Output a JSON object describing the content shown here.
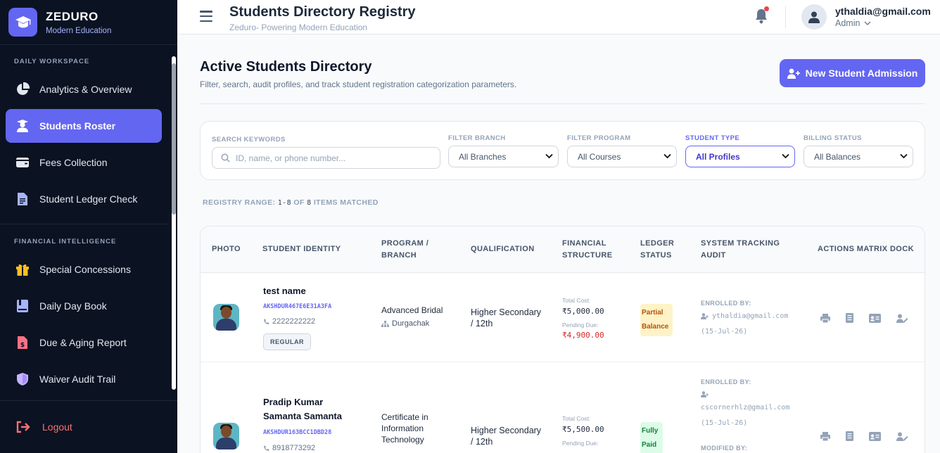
{
  "brand": {
    "name": "ZEDURO",
    "tagline": "Modern Education"
  },
  "sidebar": {
    "sections": [
      {
        "title": "DAILY WORKSPACE"
      },
      {
        "title": "FINANCIAL INTELLIGENCE"
      }
    ],
    "items": [
      {
        "label": "Analytics & Overview",
        "icon": "pie-chart-icon"
      },
      {
        "label": "Students Roster",
        "icon": "user-graduate-icon",
        "active": true
      },
      {
        "label": "Fees Collection",
        "icon": "wallet-icon"
      },
      {
        "label": "Student Ledger Check",
        "icon": "file-invoice-icon"
      },
      {
        "label": "Special Concessions",
        "icon": "gift-icon"
      },
      {
        "label": "Daily Day Book",
        "icon": "book-icon"
      },
      {
        "label": "Due & Aging Report",
        "icon": "file-dollar-icon"
      },
      {
        "label": "Waiver Audit Trail",
        "icon": "shield-icon"
      }
    ],
    "logout": "Logout"
  },
  "header": {
    "title": "Students Directory Registry",
    "subtitle": "Zeduro- Powering Modern Education",
    "user_email": "ythaldia@gmail.com",
    "user_role": "Admin"
  },
  "main": {
    "title": "Active Students Directory",
    "subtitle": "Filter, search, audit profiles, and track student registration categorization parameters.",
    "new_button": "New Student Admission"
  },
  "filters": {
    "search_label": "SEARCH KEYWORDS",
    "search_placeholder": "ID, name, or phone number...",
    "branch_label": "FILTER BRANCH",
    "branch_value": "All Branches",
    "program_label": "FILTER PROGRAM",
    "program_value": "All Courses",
    "type_label": "STUDENT TYPE",
    "type_value": "All Profiles",
    "billing_label": "BILLING STATUS",
    "billing_value": "All Balances"
  },
  "range": {
    "prefix": "REGISTRY RANGE:",
    "span": "1-8",
    "of": "OF",
    "total": "8",
    "suffix": "ITEMS MATCHED"
  },
  "table": {
    "headers": {
      "photo": "PHOTO",
      "identity": "STUDENT IDENTITY",
      "program_1": "PROGRAM /",
      "program_2": "BRANCH",
      "qualification": "QUALIFICATION",
      "financial_1": "FINANCIAL",
      "financial_2": "STRUCTURE",
      "ledger_1": "LEDGER",
      "ledger_2": "STATUS",
      "audit_1": "SYSTEM TRACKING",
      "audit_2": "AUDIT",
      "actions": "ACTIONS MATRIX DOCK"
    },
    "rows": [
      {
        "name_1": "test name",
        "id": "AKSHDUR467E6E31A3FA",
        "phone": "2222222222",
        "type": "REGULAR",
        "program": "Advanced Bridal",
        "branch": "Durgachak",
        "qual_1": "Higher Secondary",
        "qual_2": "/ 12th",
        "total_label": "Total Cost:",
        "total": "₹5,000.00",
        "due_label": "Pending Due:",
        "due": "₹4,900.00",
        "status_1": "Partial",
        "status_2": "Balance",
        "enrolled_label": "ENROLLED BY:",
        "enrolled_by": "ythaldia@gmail.com",
        "enrolled_date": "(15-Jul-26)"
      },
      {
        "name_1": "Pradip Kumar",
        "name_2": "Samanta Samanta",
        "id": "AKSHDUR163BCC1DBD28",
        "phone": "8918773292",
        "program_1": "Certificate in",
        "program_2": "Information",
        "program_3": "Technology",
        "qual_1": "Higher Secondary",
        "qual_2": "/ 12th",
        "total_label": "Total Cost:",
        "total": "₹5,500.00",
        "due_label": "Pending Due:",
        "status_1": "Fully",
        "status_2": "Paid",
        "enrolled_label": "ENROLLED BY:",
        "enrolled_by": "cscornerhlz@gmail.com",
        "enrolled_date": "(15-Jul-26)",
        "modified_label": "MODIFIED BY:"
      }
    ]
  }
}
